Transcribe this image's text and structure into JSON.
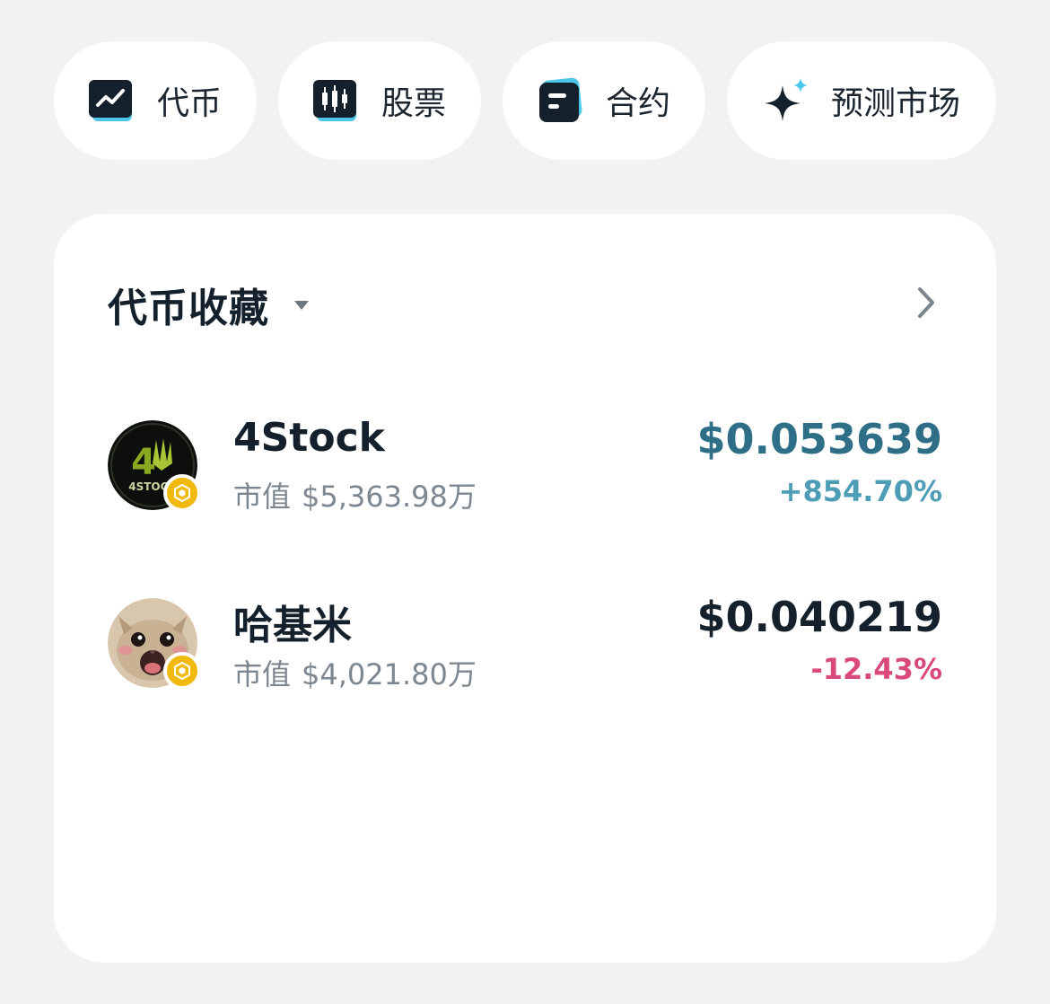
{
  "tabs": [
    {
      "label": "代币",
      "icon": "chart-line-icon"
    },
    {
      "label": "股票",
      "icon": "candlestick-icon"
    },
    {
      "label": "合约",
      "icon": "contract-card-icon"
    },
    {
      "label": "预测市场",
      "icon": "sparkle-icon"
    }
  ],
  "watchlist": {
    "title": "代币收藏",
    "tokens": [
      {
        "name": "4Stock",
        "mcap_label": "市值",
        "mcap_value": "$5,363.98万",
        "price": "$0.053639",
        "change": "+854.70%",
        "trend": "up",
        "avatar_text": "4STOCK"
      },
      {
        "name": "哈基米",
        "mcap_label": "市值",
        "mcap_value": "$4,021.80万",
        "price": "$0.040219",
        "change": "-12.43%",
        "trend": "down"
      }
    ]
  },
  "colors": {
    "background": "#f1f2f4",
    "card": "#ffffff",
    "up_price": "#2f6e87",
    "up_change": "#4d9db6",
    "down_change": "#d9497c",
    "chain_badge": "#f0b90b"
  }
}
